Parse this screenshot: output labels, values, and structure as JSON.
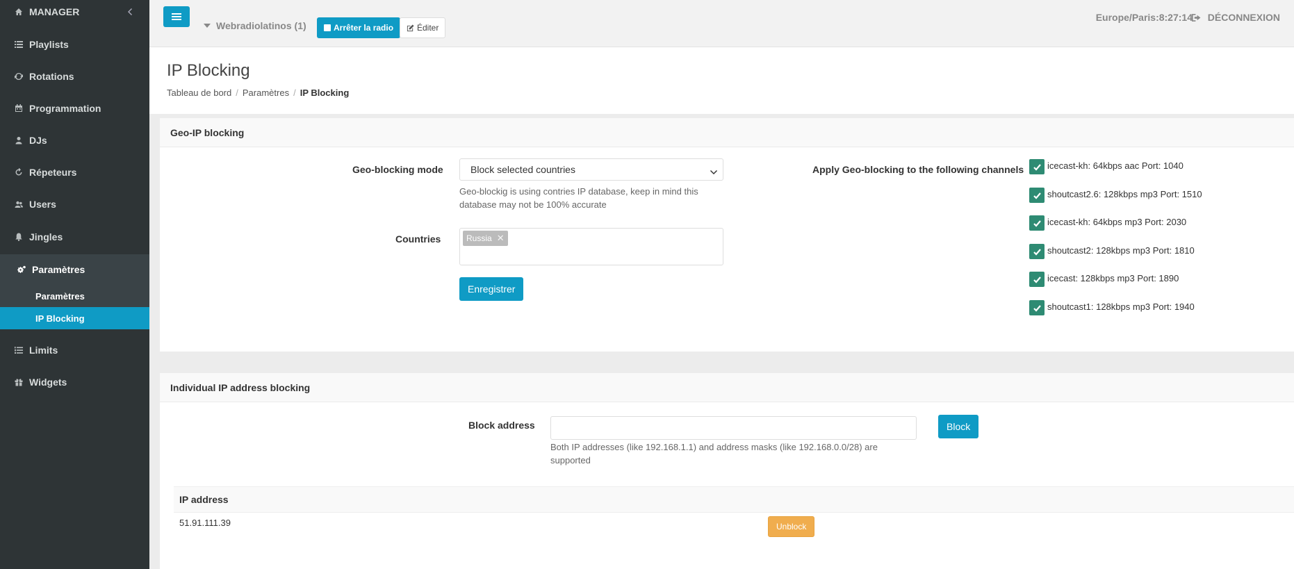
{
  "sidebar": {
    "manager": "MANAGER",
    "items": [
      {
        "label": "Playlists",
        "icon": "list-icon"
      },
      {
        "label": "Rotations",
        "icon": "refresh-icon"
      },
      {
        "label": "Programmation",
        "icon": "calendar-icon"
      },
      {
        "label": "DJs",
        "icon": "user-icon"
      },
      {
        "label": "Répeteurs",
        "icon": "repeat-icon"
      },
      {
        "label": "Users",
        "icon": "users-icon"
      },
      {
        "label": "Jingles",
        "icon": "bell-icon"
      },
      {
        "label": "Paramètres",
        "icon": "gears-icon"
      },
      {
        "label": "Limits",
        "icon": "list-ol-icon"
      },
      {
        "label": "Widgets",
        "icon": "gift-icon"
      }
    ],
    "subitems": [
      {
        "label": "Paramètres"
      },
      {
        "label": "IP Blocking"
      }
    ]
  },
  "topbar": {
    "radio_name": "Webradiolatinos (1)",
    "stop_label": "Arrêter la radio",
    "edit_label": "Éditer",
    "clock": "Europe/Paris:8:27:14",
    "logout_label": "DÉCONNEXION"
  },
  "header": {
    "title": "IP Blocking",
    "breadcrumb": [
      "Tableau de bord",
      "Paramètres",
      "IP Blocking"
    ]
  },
  "geo": {
    "panel_title": "Geo-IP blocking",
    "mode_label": "Geo-blocking mode",
    "mode_value": "Block selected countries",
    "mode_help": "Geo-blockig is using contries IP database, keep in mind this database may not be 100% accurate",
    "countries_label": "Countries",
    "countries": [
      "Russia"
    ],
    "save_label": "Enregistrer",
    "channels_label": "Apply Geo-blocking to the following channels",
    "channels": [
      "icecast-kh: 64kbps aac Port: 1040",
      "shoutcast2.6: 128kbps mp3 Port: 1510",
      "icecast-kh: 64kbps mp3 Port: 2030",
      "shoutcast2: 128kbps mp3 Port: 1810",
      "icecast: 128kbps mp3 Port: 1890",
      "shoutcast1: 128kbps mp3 Port: 1940"
    ]
  },
  "ipblock": {
    "panel_title": "Individual IP address blocking",
    "address_label": "Block address",
    "address_value": "",
    "block_label": "Block",
    "help": "Both IP addresses (like 192.168.1.1) and address masks (like 192.168.0.0/28) are supported",
    "table_header": "IP address",
    "rows": [
      {
        "ip": "51.91.111.39",
        "action": "Unblock"
      }
    ]
  }
}
